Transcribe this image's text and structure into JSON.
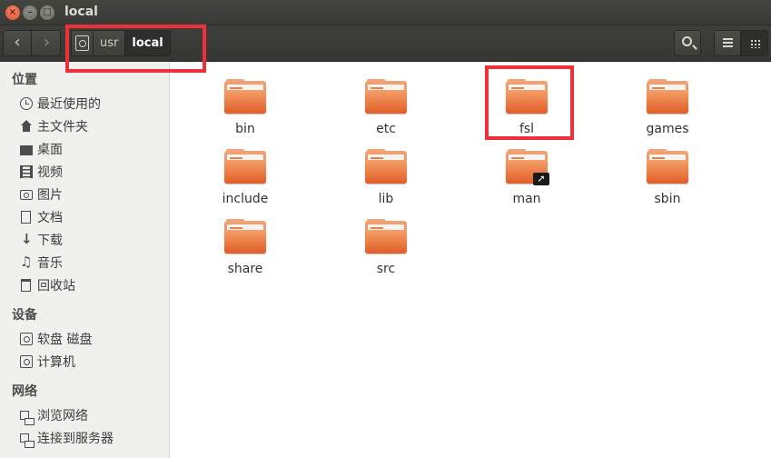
{
  "window": {
    "title": "local"
  },
  "toolbar": {
    "back_icon": "chevron-left-icon",
    "forward_icon": "chevron-right-icon",
    "path": [
      "usr",
      "local"
    ],
    "search_icon": "search-icon",
    "list_view_icon": "list-view-icon",
    "grid_view_icon": "grid-view-icon"
  },
  "sidebar": {
    "sections": [
      {
        "header": "位置",
        "items": [
          {
            "label": "最近使用的",
            "icon": "clock-icon"
          },
          {
            "label": "主文件夹",
            "icon": "home-icon"
          },
          {
            "label": "桌面",
            "icon": "desktop-icon"
          },
          {
            "label": "视频",
            "icon": "video-icon"
          },
          {
            "label": "图片",
            "icon": "camera-icon"
          },
          {
            "label": "文档",
            "icon": "document-icon"
          },
          {
            "label": "下载",
            "icon": "download-icon"
          },
          {
            "label": "音乐",
            "icon": "music-icon"
          },
          {
            "label": "回收站",
            "icon": "trash-icon"
          }
        ]
      },
      {
        "header": "设备",
        "items": [
          {
            "label": "软盘 磁盘",
            "icon": "floppy-icon"
          },
          {
            "label": "计算机",
            "icon": "drive-icon"
          }
        ]
      },
      {
        "header": "网络",
        "items": [
          {
            "label": "浏览网络",
            "icon": "network-icon"
          },
          {
            "label": "连接到服务器",
            "icon": "server-icon"
          }
        ]
      }
    ]
  },
  "files": [
    {
      "name": "bin",
      "icon": "folder-icon"
    },
    {
      "name": "etc",
      "icon": "folder-icon"
    },
    {
      "name": "fsl",
      "icon": "folder-icon"
    },
    {
      "name": "games",
      "icon": "folder-icon"
    },
    {
      "name": "include",
      "icon": "folder-icon"
    },
    {
      "name": "lib",
      "icon": "folder-icon"
    },
    {
      "name": "man",
      "icon": "folder-symlink-icon"
    },
    {
      "name": "sbin",
      "icon": "folder-icon"
    },
    {
      "name": "share",
      "icon": "folder-icon"
    },
    {
      "name": "src",
      "icon": "folder-icon"
    }
  ],
  "colors": {
    "highlight": "#ef2f3a",
    "folder": "#e8764a",
    "titlebar": "#3c3b37"
  }
}
